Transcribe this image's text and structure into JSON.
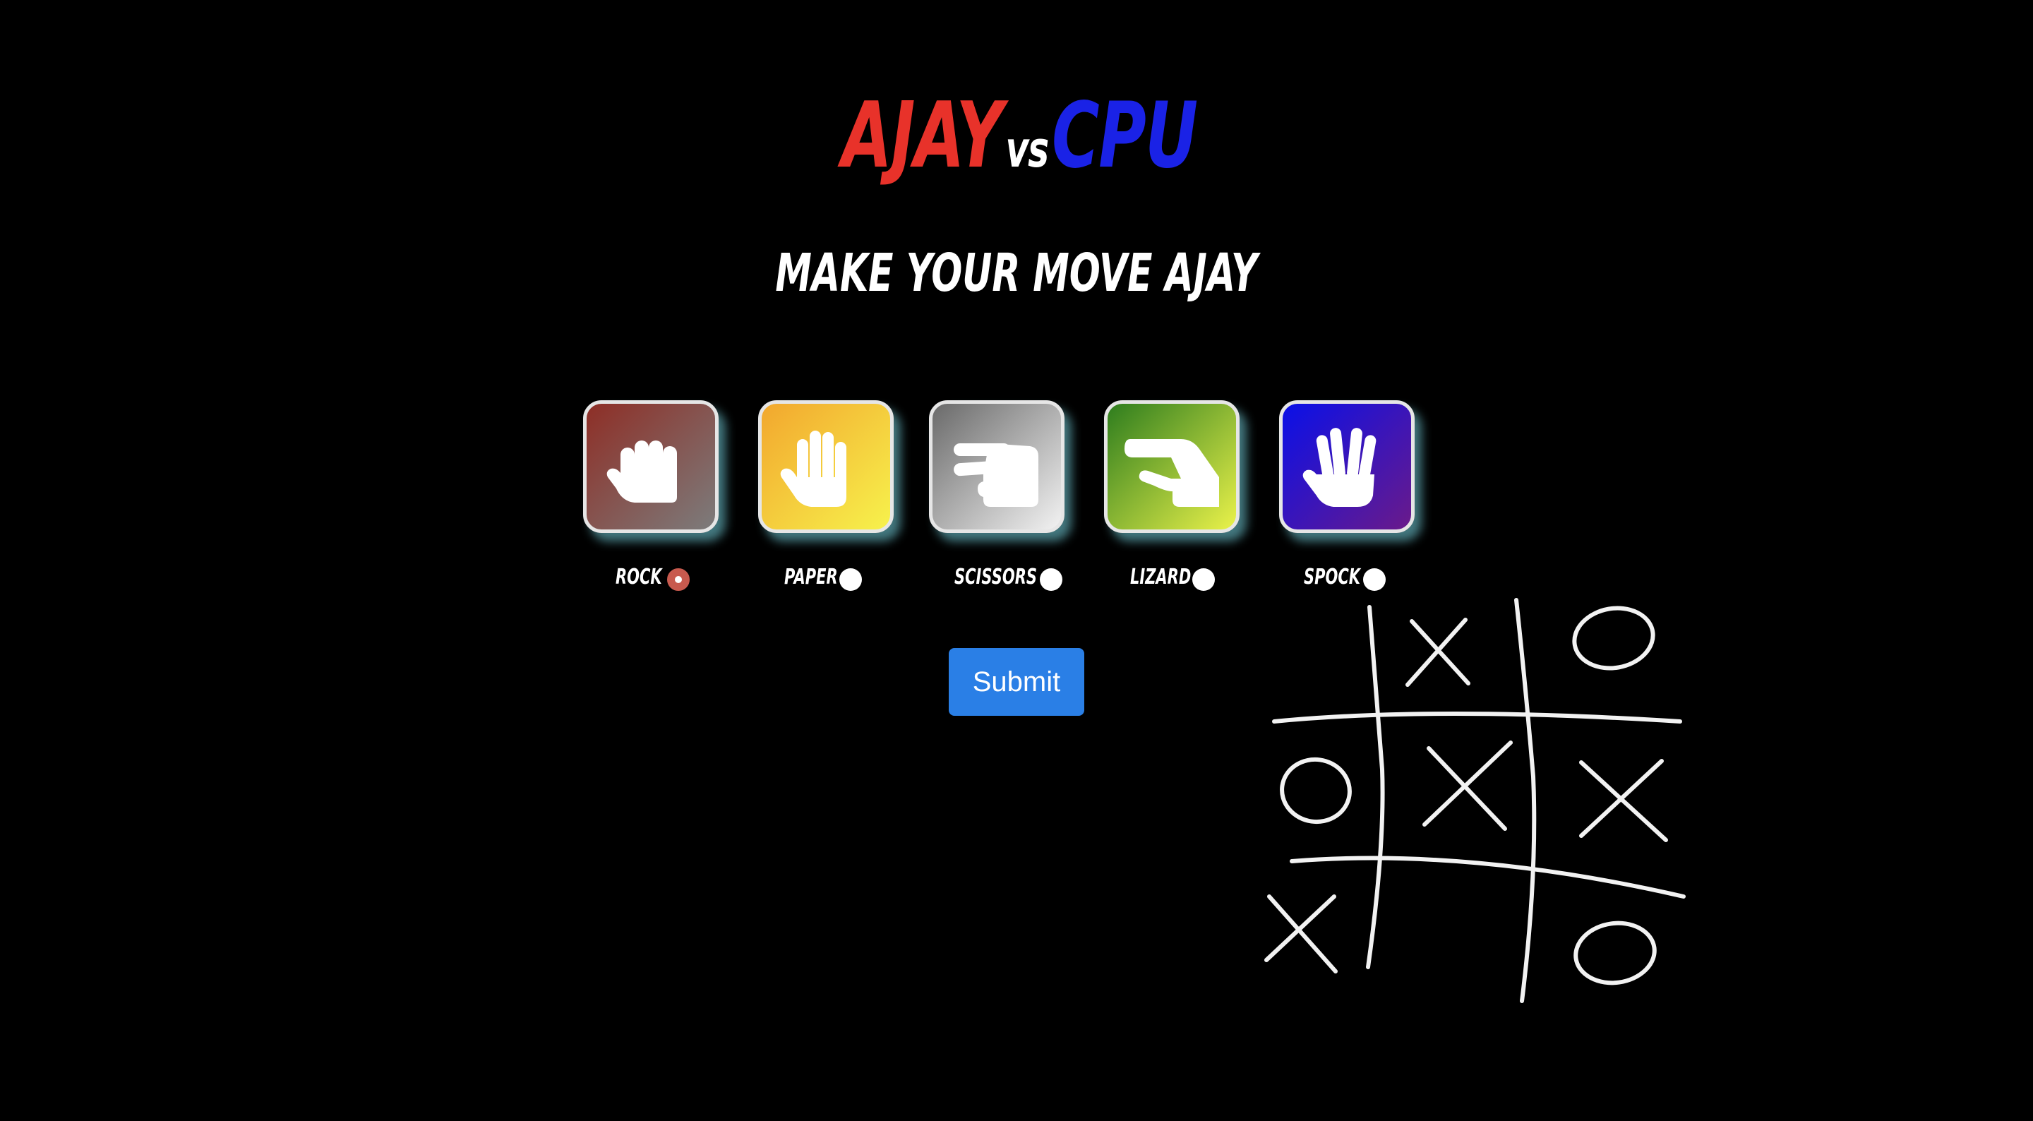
{
  "header": {
    "player_name": "AJAY",
    "vs_label": "vs",
    "opponent_name": "CPU"
  },
  "prompt": {
    "text": "MAKE YOUR MOVE AJAY"
  },
  "choices": [
    {
      "label": "ROCK",
      "icon": "fist-icon",
      "selected": true,
      "color_from": "#8e2e26",
      "color_to": "#7c7c7c"
    },
    {
      "label": "PAPER",
      "icon": "open-hand-icon",
      "selected": false,
      "color_from": "#f2a72e",
      "color_to": "#f7f24c"
    },
    {
      "label": "SCISSORS",
      "icon": "scissors-hand-icon",
      "selected": false,
      "color_from": "#6a6a6a",
      "color_to": "#f2f2f2"
    },
    {
      "label": "LIZARD",
      "icon": "lizard-hand-icon",
      "selected": false,
      "color_from": "#2e7d1e",
      "color_to": "#eaf24a"
    },
    {
      "label": "SPOCK",
      "icon": "vulcan-salute-icon",
      "selected": false,
      "color_from": "#0a10e8",
      "color_to": "#6a1a8a"
    }
  ],
  "submit": {
    "label": "Submit"
  },
  "colors": {
    "player": "#e8322a",
    "opponent": "#1a22e6",
    "button": "#2a7fe6",
    "background": "#000000"
  },
  "decoration": {
    "icon": "tic-tac-toe-chalk-icon"
  }
}
